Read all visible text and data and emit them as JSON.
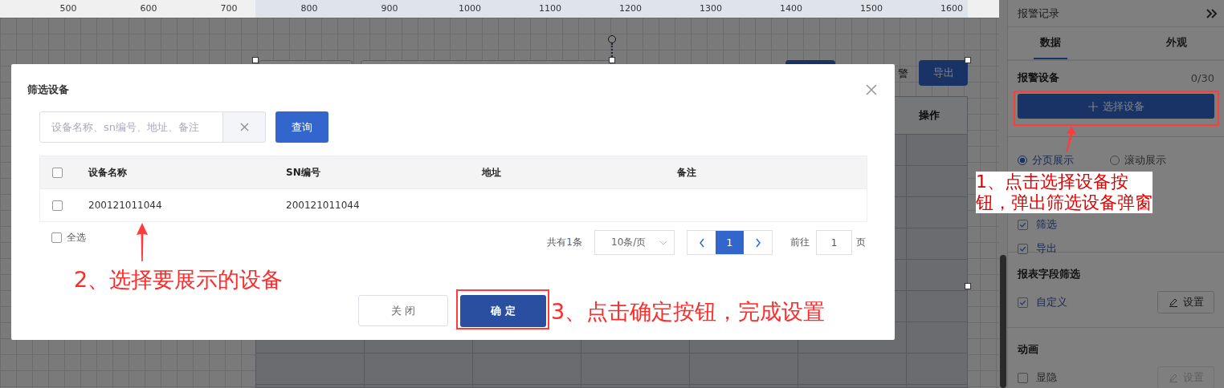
{
  "ruler": {
    "ticks": [
      "500",
      "600",
      "700",
      "800",
      "900",
      "1000",
      "1100",
      "1200",
      "1300",
      "1400",
      "1500",
      "1600"
    ]
  },
  "canvas": {
    "toolbar_text": "警",
    "export_button": "导出",
    "table": {
      "columns": [
        "操作"
      ]
    }
  },
  "panel": {
    "title": "报警记录",
    "tabs": [
      {
        "label": "数据",
        "selected": true
      },
      {
        "label": "外观",
        "selected": false
      }
    ],
    "device_section": {
      "label": "报警设备",
      "count": "0/30",
      "button": "选择设备"
    },
    "display_modes": [
      {
        "label": "分页展示",
        "selected": true
      },
      {
        "label": "滚动展示",
        "selected": false
      }
    ],
    "options": [
      {
        "label": "筛选",
        "checked": true
      },
      {
        "label": "导出",
        "checked": true
      }
    ],
    "field_filter": {
      "title": "报表字段筛选",
      "option": {
        "label": "自定义",
        "checked": true
      },
      "button": {
        "label": "设置",
        "disabled": false
      }
    },
    "animation": {
      "title": "动画",
      "option": {
        "label": "显隐",
        "checked": false
      },
      "button": {
        "label": "设置",
        "disabled": true
      }
    }
  },
  "dialog": {
    "title": "筛选设备",
    "search": {
      "placeholder": "设备名称、sn编号、地址、备注"
    },
    "query_button": "查询",
    "table": {
      "header_checked": false,
      "columns": [
        "设备名称",
        "SN编号",
        "地址",
        "备注"
      ],
      "rows": [
        {
          "checked": false,
          "name": "200121011044",
          "sn": "200121011044"
        }
      ]
    },
    "select_all": {
      "label": "全选",
      "checked": false
    },
    "pagination": {
      "total_prefix": "共有",
      "total": "1",
      "total_suffix": "条",
      "page_size": "10条/页",
      "pages": [
        {
          "label": "1",
          "selected": true
        }
      ],
      "goto_label": "前往",
      "goto_value": "1",
      "goto_suffix": "页"
    },
    "buttons": [
      {
        "label": "关 闭",
        "kind": "secondary"
      },
      {
        "label": "确 定",
        "kind": "primary"
      }
    ]
  },
  "annotations": [
    {
      "lines": [
        "1、点击选择设备按",
        "钮，弹出筛选设备弹窗"
      ]
    },
    {
      "lines": [
        "2、选择要展示的设备"
      ]
    },
    {
      "lines": [
        "3、点击确定按钮，完成设置"
      ]
    }
  ]
}
